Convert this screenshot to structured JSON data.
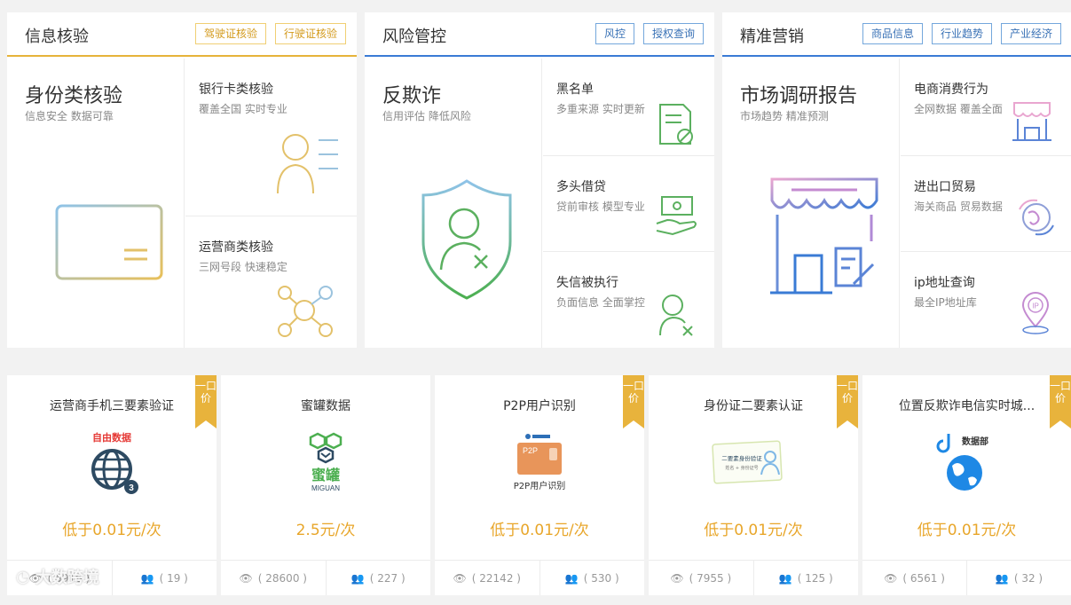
{
  "panels": [
    {
      "title": "信息核验",
      "tags": [
        "驾驶证核验",
        "行驶证核验"
      ],
      "main": {
        "title": "身份类核验",
        "sub": "信息安全 数据可靠",
        "icon": "id-card-icon"
      },
      "cells": [
        {
          "title": "银行卡类核验",
          "sub": "覆盖全国 实时专业",
          "icon": "user-list-icon"
        },
        {
          "title": "运营商类核验",
          "sub": "三网号段 快速稳定",
          "icon": "network-nodes-icon"
        }
      ]
    },
    {
      "title": "风险管控",
      "tags": [
        "风控",
        "授权查询"
      ],
      "main": {
        "title": "反欺诈",
        "sub": "信用评估 降低风险",
        "icon": "shield-user-icon"
      },
      "cells": [
        {
          "title": "黑名单",
          "sub": "多重来源 实时更新",
          "icon": "blocked-doc-icon"
        },
        {
          "title": "多头借贷",
          "sub": "贷前审核 模型专业",
          "icon": "money-hand-icon"
        },
        {
          "title": "失信被执行",
          "sub": "负面信息 全面掌控",
          "icon": "user-x-icon"
        }
      ]
    },
    {
      "title": "精准营销",
      "tags": [
        "商品信息",
        "行业趋势",
        "产业经济"
      ],
      "main": {
        "title": "市场调研报告",
        "sub": "市场趋势 精准预测",
        "icon": "storefront-icon"
      },
      "cells": [
        {
          "title": "电商消费行为",
          "sub": "全网数据 覆盖全面",
          "icon": "shop-icon"
        },
        {
          "title": "进出口贸易",
          "sub": "海关商品 贸易数据",
          "icon": "globe-icon"
        },
        {
          "title": "ip地址查询",
          "sub": "最全IP地址库",
          "icon": "ip-pin-icon"
        }
      ]
    }
  ],
  "products": [
    {
      "name": "运营商手机三要素验证",
      "price": "低于0.01元/次",
      "views": "( 5916 )",
      "users": "( 19 )",
      "ribbon": "一口价",
      "brand": "自由数据",
      "icon": "globe-chat-icon"
    },
    {
      "name": "蜜罐数据",
      "price": "2.5元/次",
      "views": "( 28600 )",
      "users": "( 227 )",
      "ribbon": "",
      "brand": "蜜罐",
      "brand2": "MIGUAN",
      "icon": "hexagon-logo-icon"
    },
    {
      "name": "P2P用户识别",
      "price": "低于0.01元/次",
      "views": "( 22142 )",
      "users": "( 530 )",
      "ribbon": "一口价",
      "brand": "P2P用户识别",
      "badge": "P2P",
      "icon": "p2p-card-icon"
    },
    {
      "name": "身份证二要素认证",
      "price": "低于0.01元/次",
      "views": "( 7955 )",
      "users": "( 125 )",
      "ribbon": "一口价",
      "brand": "二要素身份验证",
      "brand_sub": "姓名 + 身份证号",
      "icon": "id-card-verify-icon"
    },
    {
      "name": "位置反欺诈电信实时城...",
      "price": "低于0.01元/次",
      "views": "( 6561 )",
      "users": "( 32 )",
      "ribbon": "一口价",
      "brand": "数据部",
      "icon": "earth-logo-icon"
    }
  ],
  "watermark": "大数跨境",
  "colors": {
    "gold": "#e8b33c",
    "blue": "#3a7bd5",
    "price": "#e8a62a"
  }
}
